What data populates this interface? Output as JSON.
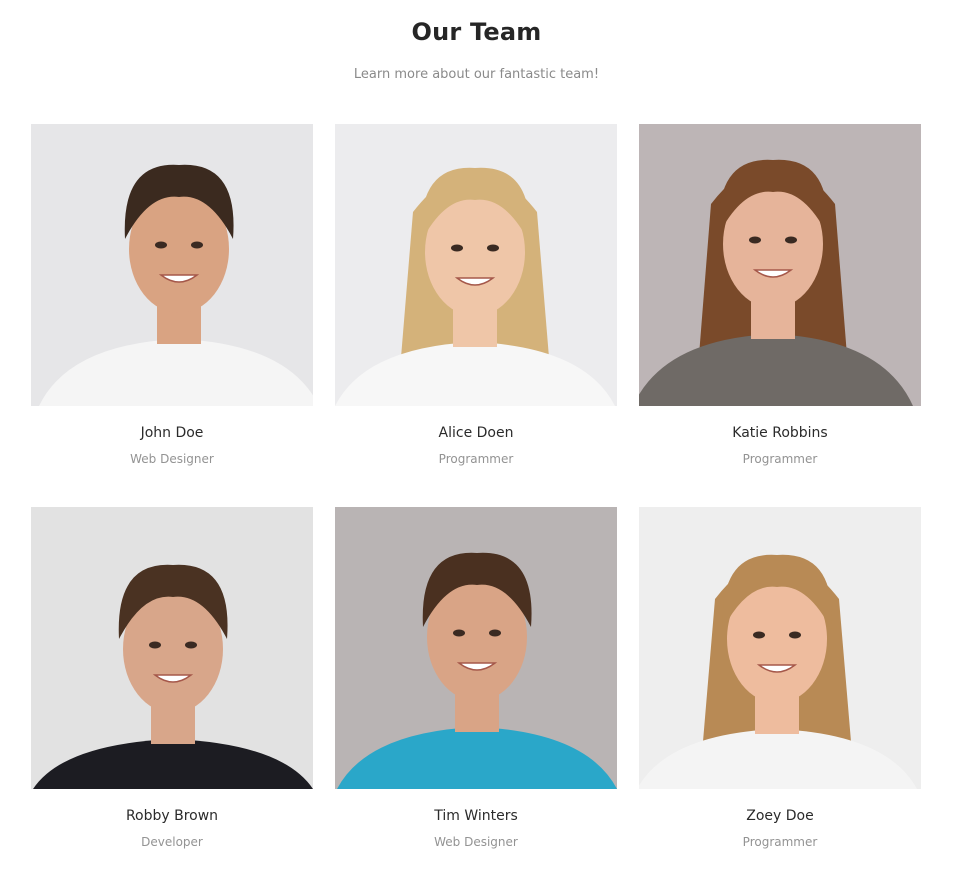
{
  "section": {
    "title": "Our Team",
    "subtitle": "Learn more about our fantastic team!"
  },
  "members": [
    {
      "name": "John Doe",
      "role": "Web Designer",
      "photo": "portrait-man-short-dark-hair-white-shirt",
      "bg": "#e6e6e8",
      "hair": "#3b2a1f",
      "skin": "#d9a382",
      "shirt": "#f5f5f5"
    },
    {
      "name": "Alice Doen",
      "role": "Programmer",
      "photo": "portrait-woman-blonde-hair-white-shirt",
      "bg": "#ececee",
      "hair": "#d4b27a",
      "skin": "#efc6a8",
      "shirt": "#f7f7f7"
    },
    {
      "name": "Katie Robbins",
      "role": "Programmer",
      "photo": "portrait-woman-long-brown-hair-grey-top",
      "bg": "#bdb5b6",
      "hair": "#7a4a2a",
      "skin": "#e6b49a",
      "shirt": "#6f6a66"
    },
    {
      "name": "Robby Brown",
      "role": "Developer",
      "photo": "portrait-man-wavy-hair-black-turtleneck",
      "bg": "#e2e2e2",
      "hair": "#4a3222",
      "skin": "#d8a68a",
      "shirt": "#1c1c22"
    },
    {
      "name": "Tim Winters",
      "role": "Web Designer",
      "photo": "portrait-man-short-hair-blue-tshirt",
      "bg": "#b9b4b4",
      "hair": "#4a3020",
      "skin": "#d9a486",
      "shirt": "#2aa7c9"
    },
    {
      "name": "Zoey Doe",
      "role": "Programmer",
      "photo": "portrait-woman-long-blonde-hair-white-top",
      "bg": "#eeeeee",
      "hair": "#b88a55",
      "skin": "#eebc9e",
      "shirt": "#f4f4f4"
    }
  ]
}
